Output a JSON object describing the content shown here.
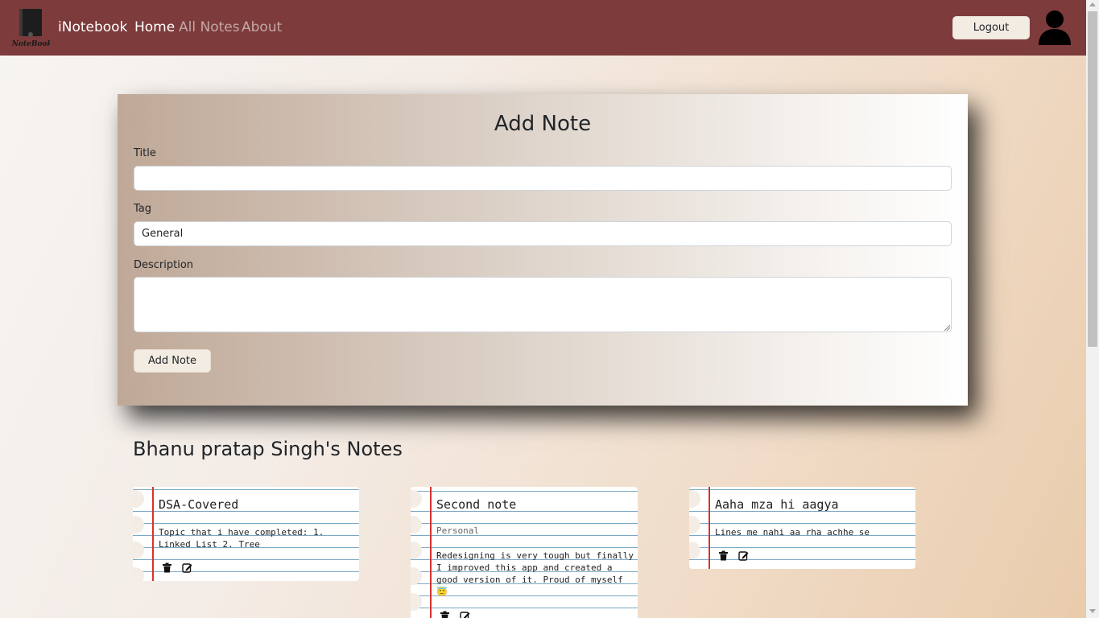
{
  "navbar": {
    "brand": "iNotebook",
    "logo_icon": "notebook-logo-icon",
    "logo_caption": "iNoteBook",
    "links": [
      {
        "label": "Home",
        "active": true
      },
      {
        "label": "All Notes",
        "active": false
      },
      {
        "label": "About",
        "active": false
      }
    ],
    "logout_label": "Logout",
    "avatar_icon": "user-avatar-icon",
    "background_color": "#7d3b3b"
  },
  "add_note": {
    "heading": "Add Note",
    "title_label": "Title",
    "title_value": "",
    "tag_label": "Tag",
    "tag_value": "General",
    "description_label": "Description",
    "description_value": "",
    "submit_label": "Add Note"
  },
  "notes_section": {
    "heading": "Bhanu pratap Singh's Notes",
    "notes": [
      {
        "title": "DSA-Covered",
        "tag": "",
        "description": "Topic that i have completed: 1. Linked List 2. Tree"
      },
      {
        "title": "Second note",
        "tag": "Personal",
        "description": "Redesigning is very tough but finally I improved this app and created a good version of it. Proud of myself 😇"
      },
      {
        "title": "Aaha mza hi aagya",
        "tag": "",
        "description": "Lines me nahi aa rha achhe se"
      }
    ],
    "delete_icon": "trash-icon",
    "edit_icon": "edit-icon"
  }
}
